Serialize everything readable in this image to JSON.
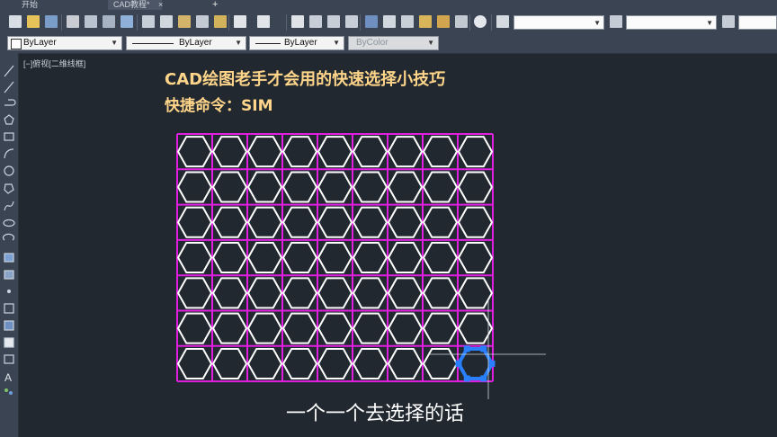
{
  "tabs": {
    "start": "开始",
    "drawing": "CAD教程*",
    "close_glyph": "×",
    "add_glyph": "+"
  },
  "properties": {
    "layer": "ByLayer",
    "linetype": "ByLayer",
    "lineweight": "ByLayer",
    "plotstyle": "ByColor"
  },
  "viewport": {
    "label": "[−]俯视[二维线框]"
  },
  "overlay": {
    "title": "CAD绘图老手才会用的快速选择小技巧",
    "shortcut": "快捷命令：SIM",
    "subtitle": "一个一个去选择的话"
  },
  "colors": {
    "canvas": "#212830",
    "grid_line": "#e01fe0",
    "hexagon": "#ffffff",
    "selected": "#2a7fff",
    "title_text": "#ffd58a"
  },
  "hex_grid": {
    "columns": 9,
    "rows": 7,
    "selected_cell": [
      6,
      8
    ]
  }
}
